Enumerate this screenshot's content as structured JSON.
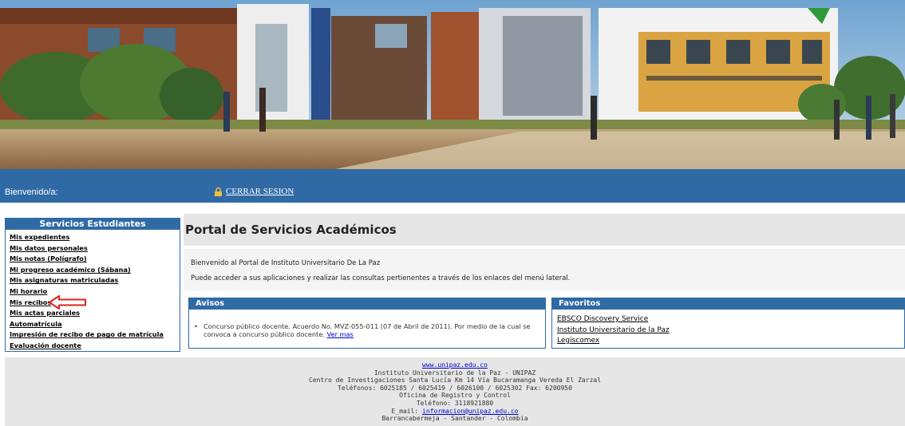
{
  "session": {
    "welcome": "Bienvenido/a:",
    "logout_label": "CERRAR SESION"
  },
  "sidebar": {
    "title": "Servicios Estudiantes",
    "items": [
      {
        "label": "Mis expedientes"
      },
      {
        "label": "Mis datos personales"
      },
      {
        "label": "Mis notas (Polígrafo)"
      },
      {
        "label": "Mi progreso académico (Sábana)"
      },
      {
        "label": "Mis asignaturas matriculadas"
      },
      {
        "label": "Mi horario"
      },
      {
        "label": "Mis recibos"
      },
      {
        "label": "Mis actas parciales"
      },
      {
        "label": "Automatrícula"
      },
      {
        "label": "Impresión de recibo de pago de matrícula"
      },
      {
        "label": "Evaluación docente"
      }
    ]
  },
  "main": {
    "title": "Portal de Servicios Académicos",
    "intro_line1": "Bienvenido al Portal de Instituto Universitario De La Paz",
    "intro_line2": "Puede acceder a sus aplicaciones y realizar las consultas pertienentes  a través de los enlaces del menú lateral."
  },
  "avisos": {
    "title": "Avisos",
    "item_text": "Concurso público docente. Acuerdo No. MVZ-055-011 (07 de Abril de 2011). Por medio de la cual se convoca a concurso público docente.",
    "item_link": "Ver mas"
  },
  "favoritos": {
    "title": "Favoritos",
    "links": [
      {
        "label": "EBSCO Discovery Service"
      },
      {
        "label": "Instituto Universitario de la Paz"
      },
      {
        "label": "Legiscomex"
      }
    ]
  },
  "footer": {
    "website": "www.unipaz.edu.co",
    "line1": "Instituto Universitario de la Paz - UNIPAZ",
    "line2": "Centro de Investigaciones Santa Lucía Km 14 Vía Bucaramanga Vereda El Zarzal",
    "line3": "Teléfonos: 6025185 / 6025419 / 6026100 / 6025302 Fax: 6200950",
    "line4": "Oficina de Registro y Control",
    "line5": "Teléfono: 3118921880",
    "email_label": "E_mail: ",
    "email": "informacion@unipaz.edu.co",
    "line6": "Barrancabermeja - Santander - Colombia"
  },
  "colors": {
    "brand_blue": "#2f6aa5",
    "arrow_red": "#e02020",
    "link_blue": "#0000cc"
  }
}
